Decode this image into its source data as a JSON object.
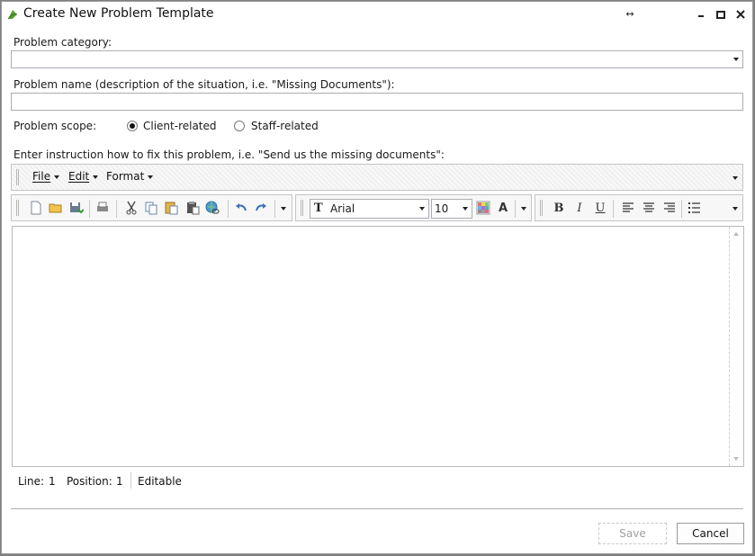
{
  "window": {
    "title": "Create New Problem Template",
    "icons": [
      "app-leaf-icon",
      "resize-horizontal-icon",
      "minimize-icon",
      "maximize-icon",
      "close-icon"
    ]
  },
  "form": {
    "category_label": "Problem category:",
    "category_value": "",
    "name_label": "Problem name (description of the situation, i.e. \"Missing Documents\"):",
    "name_value": "",
    "scope_label": "Problem scope:",
    "scope_options": [
      {
        "label": "Client-related",
        "checked": true
      },
      {
        "label": "Staff-related",
        "checked": false
      }
    ],
    "instruction_label": "Enter instruction how to fix this problem, i.e. \"Send us the missing documents\":"
  },
  "menubar": {
    "items": [
      {
        "label": "File",
        "accel": "F"
      },
      {
        "label": "Edit",
        "accel": "E"
      },
      {
        "label": "Format",
        "accel": "o"
      }
    ]
  },
  "toolbar": {
    "icons": [
      "new-document-icon",
      "open-folder-icon",
      "save-icon",
      "print-icon",
      "cut-icon",
      "copy-icon",
      "paste-icon",
      "paste-special-icon",
      "insert-hyperlink-icon",
      "undo-icon",
      "redo-icon",
      "font-icon",
      "color-grid-icon",
      "font-color-icon",
      "bold-icon",
      "italic-icon",
      "underline-icon",
      "align-left-icon",
      "align-center-icon",
      "align-right-icon",
      "bullet-list-icon"
    ],
    "font_name": "Arial",
    "font_size": "10",
    "font_color_glyph": "A",
    "bold_glyph": "B",
    "italic_glyph": "I",
    "underline_glyph": "U"
  },
  "editor": {
    "content": ""
  },
  "status": {
    "line_label": "Line:",
    "line_value": "1",
    "position_label": "Position:",
    "position_value": "1",
    "mode": "Editable"
  },
  "buttons": {
    "save": "Save",
    "cancel": "Cancel"
  },
  "colors": {
    "border": "#abadb3",
    "toolbar_bg": "#f7f7f7",
    "disabled_text": "#a0a0a0",
    "accent_green": "#5aa830"
  }
}
